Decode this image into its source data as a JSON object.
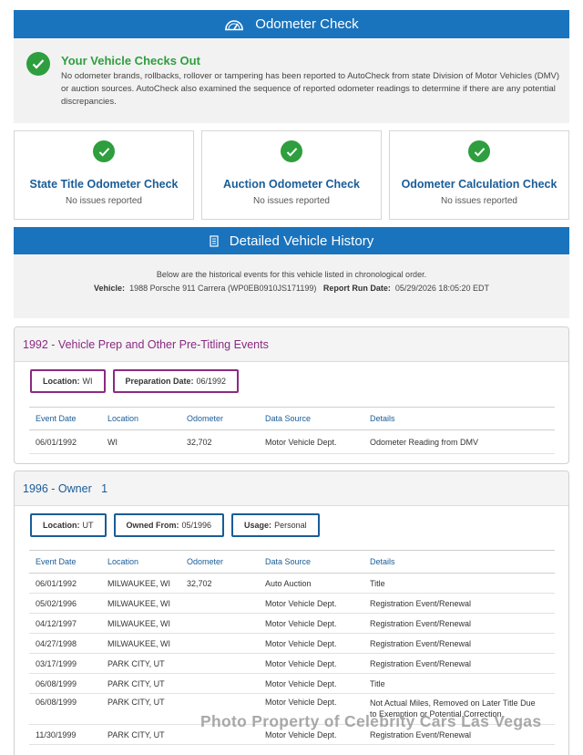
{
  "odometer_banner": {
    "title": "Odometer Check",
    "icon": "speedometer-icon"
  },
  "checks_out": {
    "title": "Your Vehicle Checks Out",
    "description": "No odometer brands, rollbacks, rollover or tampering has been reported to AutoCheck from state Division of Motor Vehicles (DMV) or auction sources. AutoCheck also examined the sequence of reported odometer readings to determine if there are any potential discrepancies."
  },
  "cards": [
    {
      "title": "State Title Odometer Check",
      "status": "No issues reported"
    },
    {
      "title": "Auction Odometer Check",
      "status": "No issues reported"
    },
    {
      "title": "Odometer Calculation Check",
      "status": "No issues reported"
    }
  ],
  "history_banner": {
    "title": "Detailed Vehicle History",
    "icon": "document-icon"
  },
  "intro": {
    "line1": "Below are the historical events for this vehicle listed in chronological order.",
    "vehicle_label": "Vehicle:",
    "vehicle_value": "1988 Porsche 911 Carrera (WP0EB0910JS171199)",
    "run_date_label": "Report Run Date:",
    "run_date_value": "05/29/2026 18:05:20 EDT"
  },
  "columns": [
    "Event Date",
    "Location",
    "Odometer",
    "Data Source",
    "Details"
  ],
  "section1": {
    "title": "1992 - Vehicle Prep and Other Pre-Titling Events",
    "tags": [
      {
        "label": "Location:",
        "value": "WI"
      },
      {
        "label": "Preparation Date:",
        "value": "06/1992"
      }
    ],
    "rows": [
      [
        "06/01/1992",
        "WI",
        "32,702",
        "Motor Vehicle Dept.",
        "Odometer Reading from DMV"
      ]
    ]
  },
  "section2": {
    "title": "1996 - Owner   1",
    "tags": [
      {
        "label": "Location:",
        "value": "UT"
      },
      {
        "label": "Owned From:",
        "value": "05/1996"
      },
      {
        "label": "Usage:",
        "value": "Personal"
      }
    ],
    "rows": [
      [
        "06/01/1992",
        "MILWAUKEE, WI",
        "32,702",
        "Auto Auction",
        "Title"
      ],
      [
        "05/02/1996",
        "MILWAUKEE, WI",
        "",
        "Motor Vehicle Dept.",
        "Registration Event/Renewal"
      ],
      [
        "04/12/1997",
        "MILWAUKEE, WI",
        "",
        "Motor Vehicle Dept.",
        "Registration Event/Renewal"
      ],
      [
        "04/27/1998",
        "MILWAUKEE, WI",
        "",
        "Motor Vehicle Dept.",
        "Registration Event/Renewal"
      ],
      [
        "03/17/1999",
        "PARK CITY, UT",
        "",
        "Motor Vehicle Dept.",
        "Registration Event/Renewal"
      ],
      [
        "06/08/1999",
        "PARK CITY, UT",
        "",
        "Motor Vehicle Dept.",
        "Title"
      ],
      [
        "06/08/1999",
        "PARK CITY, UT",
        "",
        "Motor Vehicle Dept.",
        "Not Actual Miles, Removed on Later Title Due to Exemption or Potential Correction"
      ],
      [
        "11/30/1999",
        "PARK CITY, UT",
        "",
        "Motor Vehicle Dept.",
        "Registration Event/Renewal"
      ]
    ]
  },
  "watermark": "Photo Property of Celebrity Cars Las Vegas",
  "colors": {
    "banner": "#1a73bd",
    "check_green": "#2e9e3e",
    "section1_accent": "#8a2a82",
    "section2_accent": "#1a5c97"
  }
}
